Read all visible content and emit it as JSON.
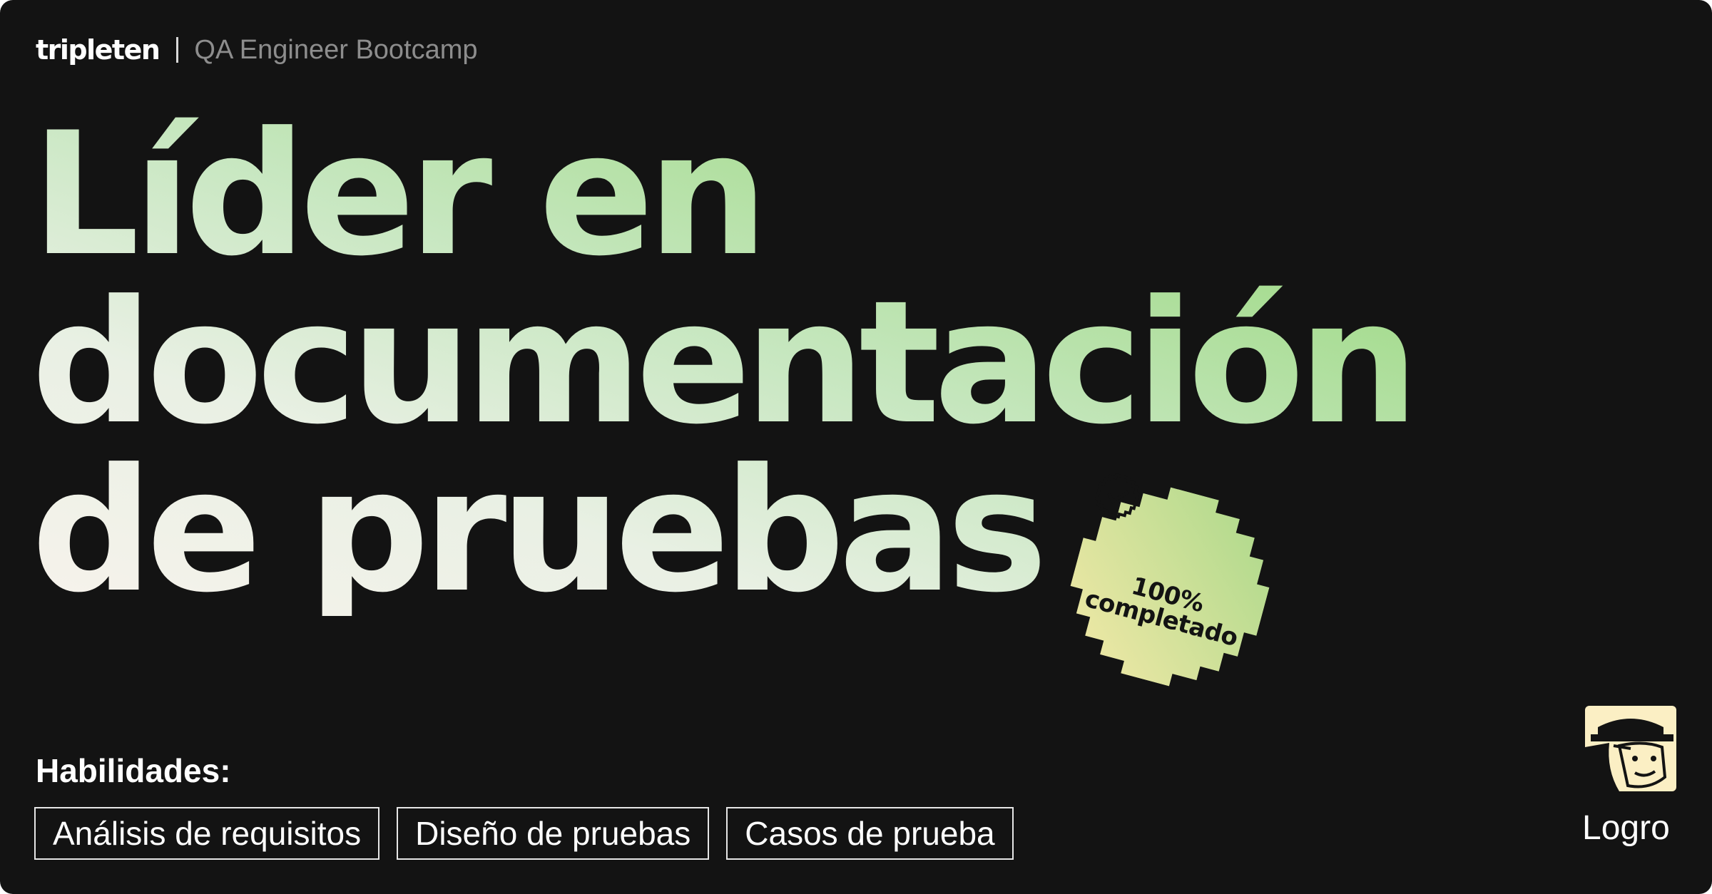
{
  "brand": {
    "logo": "tripleten",
    "course": "QA Engineer Bootcamp"
  },
  "headline": {
    "line1": "Líder en",
    "line2": "documentación",
    "line3": "de pruebas"
  },
  "badge": {
    "percent": "100%",
    "status": "completado",
    "icon": "check-circle-icon",
    "colors": {
      "start": "#f5e9a8",
      "end": "#a9d88a"
    }
  },
  "skills": {
    "label": "Habilidades:",
    "items": [
      "Análisis de requisitos",
      "Diseño de pruebas",
      "Casos de prueba"
    ]
  },
  "achievement": {
    "label": "Logro",
    "icon": "detective-avatar-icon",
    "color": "#fbefc4"
  },
  "theme": {
    "background": "#131313",
    "gradient": [
      "#8fd470",
      "#f7f3ec"
    ]
  }
}
